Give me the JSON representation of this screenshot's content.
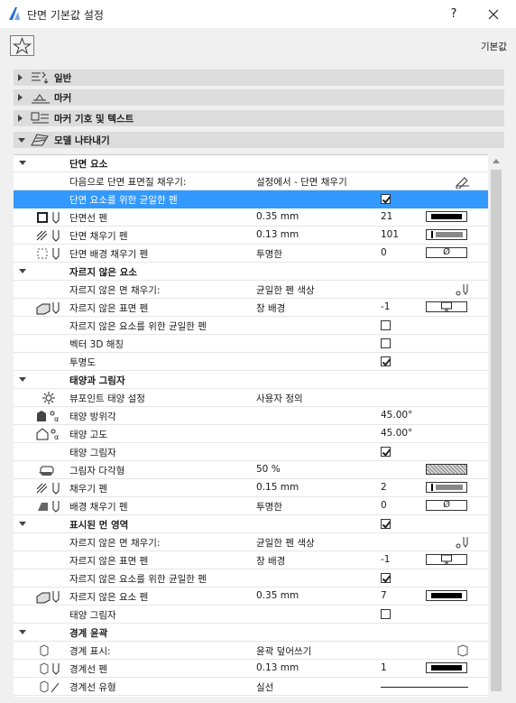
{
  "window": {
    "title": "단면 기본값 설정",
    "help": "?",
    "close": "✕"
  },
  "toolbar": {
    "default_label": "기본값"
  },
  "sections": [
    {
      "label": "일반",
      "icon": "general-settings-icon",
      "expanded": false
    },
    {
      "label": "마커",
      "icon": "marker-icon",
      "expanded": false
    },
    {
      "label": "마커 기호 및 텍스트",
      "icon": "marker-text-icon",
      "expanded": false
    },
    {
      "label": "모델 나타내기",
      "icon": "model-display-icon",
      "expanded": true
    }
  ],
  "rows": [
    {
      "type": "group",
      "label": "단면 요소"
    },
    {
      "label": "다음으로 단면 표면질 채우기:",
      "value": "설정에서 - 단면 채우기",
      "end_icon": "pencil-ruler-icon"
    },
    {
      "label": "단면 요소를 위한 균일한 펜",
      "checkbox": true,
      "selected": true
    },
    {
      "label": "단면선 펜",
      "icon": "cut-line-pen-icon",
      "value": "0.35 mm",
      "num": "21",
      "pen": "thick"
    },
    {
      "label": "단면 채우기 펜",
      "icon": "cut-fill-pen-icon",
      "value": "0.13 mm",
      "num": "101",
      "pen": "gray"
    },
    {
      "label": "단면 배경 채우기 펜",
      "icon": "cut-background-pen-icon",
      "value": "투명한",
      "num": "0",
      "pen": "none",
      "pen_text": "Ø"
    },
    {
      "type": "group",
      "label": "자르지 않은 요소"
    },
    {
      "label": "자르지 않은 면 채우기:",
      "value": "균일한 펜 색상",
      "end_icon": "pen-settings-icon"
    },
    {
      "label": "자르지 않은 표면 펜",
      "icon": "uncut-surface-pen-icon",
      "value": "창 배경",
      "num": "-1",
      "pen": "window"
    },
    {
      "label": "자르지 않은 요소를 위한 균일한 펜",
      "checkbox": false
    },
    {
      "label": "벡터 3D 해칭",
      "checkbox": false
    },
    {
      "label": "투명도",
      "checkbox": true
    },
    {
      "type": "group",
      "label": "태양과 그림자"
    },
    {
      "label": "뷰포인트 태양 설정",
      "icon": "sun-icon",
      "value": "사용자 정의"
    },
    {
      "label": "태양 방위각",
      "icon": "sun-azimuth-icon",
      "num": "45.00°"
    },
    {
      "label": "태양 고도",
      "icon": "sun-altitude-icon",
      "num": "45.00°"
    },
    {
      "label": "태양 그림자",
      "checkbox": true
    },
    {
      "label": "그림자 다각형",
      "icon": "shadow-polygon-icon",
      "value": "50 %",
      "pen": "hatch"
    },
    {
      "label": "채우기 펜",
      "icon": "fill-pen-icon",
      "value": "0.15 mm",
      "num": "2",
      "pen": "gray"
    },
    {
      "label": "배경 채우기 펜",
      "icon": "background-fill-pen-icon",
      "value": "투명한",
      "num": "0",
      "pen": "none",
      "pen_text": "Ø"
    },
    {
      "type": "group",
      "label": "표시된 먼 영역",
      "checkbox": true
    },
    {
      "label": "자르지 않은 면 채우기:",
      "value": "균일한 펜 색상",
      "end_icon": "pen-settings-icon"
    },
    {
      "label": "자르지 않은 표면 펜",
      "value": "창 배경",
      "num": "-1",
      "pen": "window"
    },
    {
      "label": "자르지 않은 요소를 위한 균일한 펜",
      "checkbox": true
    },
    {
      "label": "자르지 않은 요소 펜",
      "icon": "uncut-element-pen-icon",
      "value": "0.35 mm",
      "num": "7",
      "pen": "thick"
    },
    {
      "label": "태양 그림자",
      "checkbox": false
    },
    {
      "type": "group",
      "label": "경계 윤곽"
    },
    {
      "label": "경계 표시:",
      "icon": "boundary-display-icon",
      "value": "윤곽 덮어쓰기",
      "end_icon": "box-icon"
    },
    {
      "label": "경계선 펜",
      "icon": "boundary-pen-icon",
      "value": "0.13 mm",
      "num": "1",
      "pen": "thick"
    },
    {
      "label": "경계선 유형",
      "icon": "boundary-line-type-icon",
      "value": "실선",
      "line": true
    }
  ],
  "colors": {
    "selection": "#3399ff",
    "section_bg": "#dcdcdc",
    "frame": "#f0f0f0"
  }
}
